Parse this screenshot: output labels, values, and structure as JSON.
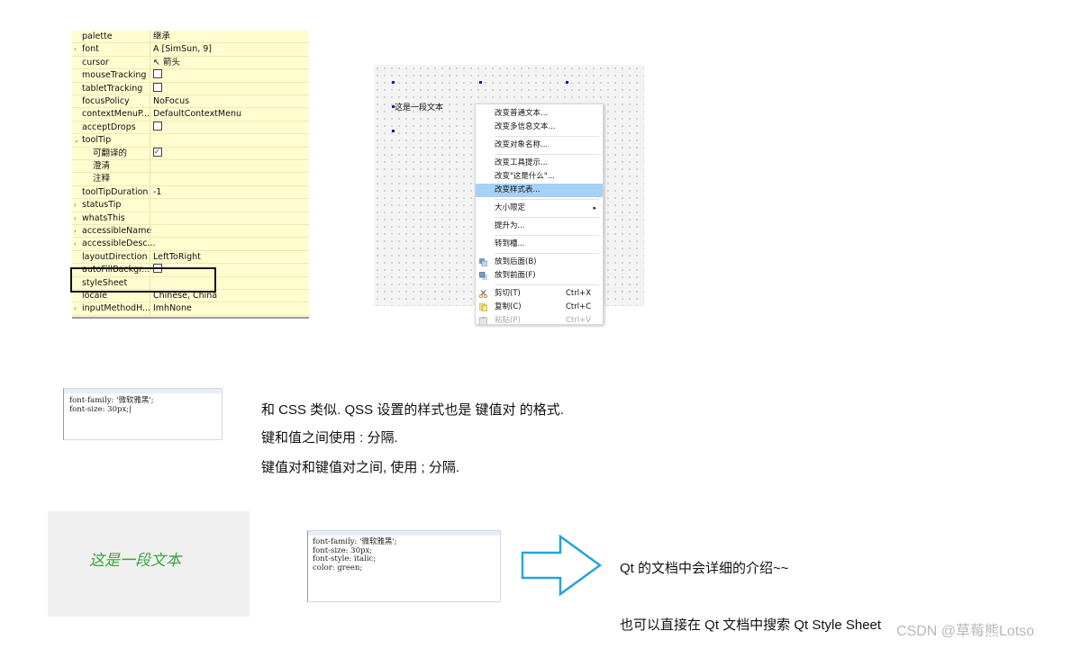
{
  "property_panel": {
    "rows": [
      {
        "name": "palette",
        "value": "继承",
        "indent": 0,
        "arrow": ""
      },
      {
        "name": "font",
        "value": "A [SimSun, 9]",
        "indent": 0,
        "arrow": "›"
      },
      {
        "name": "cursor",
        "value": "↖ 箭头",
        "indent": 0,
        "arrow": ""
      },
      {
        "name": "mouseTracking",
        "value": "",
        "checkbox": true,
        "checked": false,
        "indent": 0,
        "arrow": ""
      },
      {
        "name": "tabletTracking",
        "value": "",
        "checkbox": true,
        "checked": false,
        "indent": 0,
        "arrow": ""
      },
      {
        "name": "focusPolicy",
        "value": "NoFocus",
        "indent": 0,
        "arrow": ""
      },
      {
        "name": "contextMenuP...",
        "value": "DefaultContextMenu",
        "indent": 0,
        "arrow": ""
      },
      {
        "name": "acceptDrops",
        "value": "",
        "checkbox": true,
        "checked": false,
        "indent": 0,
        "arrow": ""
      },
      {
        "name": "toolTip",
        "value": "",
        "indent": 0,
        "arrow": "⌄"
      },
      {
        "name": "可翻译的",
        "value": "",
        "checkbox": true,
        "checked": true,
        "indent": 1,
        "arrow": ""
      },
      {
        "name": "澄清",
        "value": "",
        "indent": 1,
        "arrow": ""
      },
      {
        "name": "注释",
        "value": "",
        "indent": 1,
        "arrow": ""
      },
      {
        "name": "toolTipDuration",
        "value": "-1",
        "indent": 0,
        "arrow": ""
      },
      {
        "name": "statusTip",
        "value": "",
        "indent": 0,
        "arrow": "›"
      },
      {
        "name": "whatsThis",
        "value": "",
        "indent": 0,
        "arrow": "›"
      },
      {
        "name": "accessibleName",
        "value": "",
        "indent": 0,
        "arrow": "›"
      },
      {
        "name": "accessibleDesc...",
        "value": "",
        "indent": 0,
        "arrow": "›"
      },
      {
        "name": "layoutDirection",
        "value": "LeftToRight",
        "indent": 0,
        "arrow": ""
      },
      {
        "name": "autoFillBackgr...",
        "value": "",
        "checkbox": true,
        "checked": false,
        "indent": 0,
        "arrow": ""
      },
      {
        "name": "styleSheet",
        "value": "",
        "indent": 0,
        "arrow": ""
      },
      {
        "name": "locale",
        "value": "Chinese, China",
        "indent": 0,
        "arrow": ""
      },
      {
        "name": "inputMethodH...",
        "value": "ImhNone",
        "indent": 0,
        "arrow": "›"
      }
    ]
  },
  "form_label": "这是一段文本",
  "context_menu": {
    "items": [
      {
        "type": "item",
        "label": "改变普通文本...",
        "shortcut": ""
      },
      {
        "type": "item",
        "label": "改变多信息文本...",
        "shortcut": ""
      },
      {
        "type": "sep"
      },
      {
        "type": "item",
        "label": "改变对象名称...",
        "shortcut": ""
      },
      {
        "type": "sep"
      },
      {
        "type": "item",
        "label": "改变工具提示...",
        "shortcut": ""
      },
      {
        "type": "item",
        "label": "改变\"这是什么\"...",
        "shortcut": ""
      },
      {
        "type": "item",
        "label": "改变样式表...",
        "shortcut": "",
        "selected": true
      },
      {
        "type": "sep"
      },
      {
        "type": "item",
        "label": "大小限定",
        "shortcut": "",
        "submenu": true
      },
      {
        "type": "sep"
      },
      {
        "type": "item",
        "label": "提升为...",
        "shortcut": ""
      },
      {
        "type": "sep"
      },
      {
        "type": "item",
        "label": "转到槽...",
        "shortcut": ""
      },
      {
        "type": "sep"
      },
      {
        "type": "item",
        "label": "放到后面(B)",
        "shortcut": "",
        "icon": "send-back-icon"
      },
      {
        "type": "item",
        "label": "放到前面(F)",
        "shortcut": "",
        "icon": "bring-front-icon"
      },
      {
        "type": "sep"
      },
      {
        "type": "item",
        "label": "剪切(T)",
        "shortcut": "Ctrl+X",
        "icon": "cut-icon"
      },
      {
        "type": "item",
        "label": "复制(C)",
        "shortcut": "Ctrl+C",
        "icon": "copy-icon"
      },
      {
        "type": "item",
        "label": "粘贴(P)",
        "shortcut": "Ctrl+V",
        "icon": "paste-icon",
        "disabled": true
      }
    ],
    "submenu_arrow": "▸"
  },
  "code1": {
    "lines": [
      "font-family: '微软雅黑';",
      "font-size: 30px;|"
    ]
  },
  "explain": {
    "line1": "和 CSS 类似. QSS 设置的样式也是 键值对 的格式.",
    "line2": "键和值之间使用 : 分隔.",
    "line3": "键值对和键值对之间, 使用 ; 分隔."
  },
  "preview_text": "这是一段文本",
  "code2": {
    "lines": [
      "font-family: '微软雅黑';",
      "font-size: 30px;",
      "font-style: italic;",
      "color: green;"
    ]
  },
  "note1": "Qt 的文档中会详细的介绍~~",
  "note2": "也可以直接在 Qt 文档中搜索 Qt Style Sheet",
  "watermark": "CSDN @草莓熊Lotso",
  "colors": {
    "panel_bg": "#fffdd0",
    "menu_highlight": "#a7d0f5",
    "arrow_outline": "#29a3d9",
    "preview_text": "#3da33d"
  }
}
